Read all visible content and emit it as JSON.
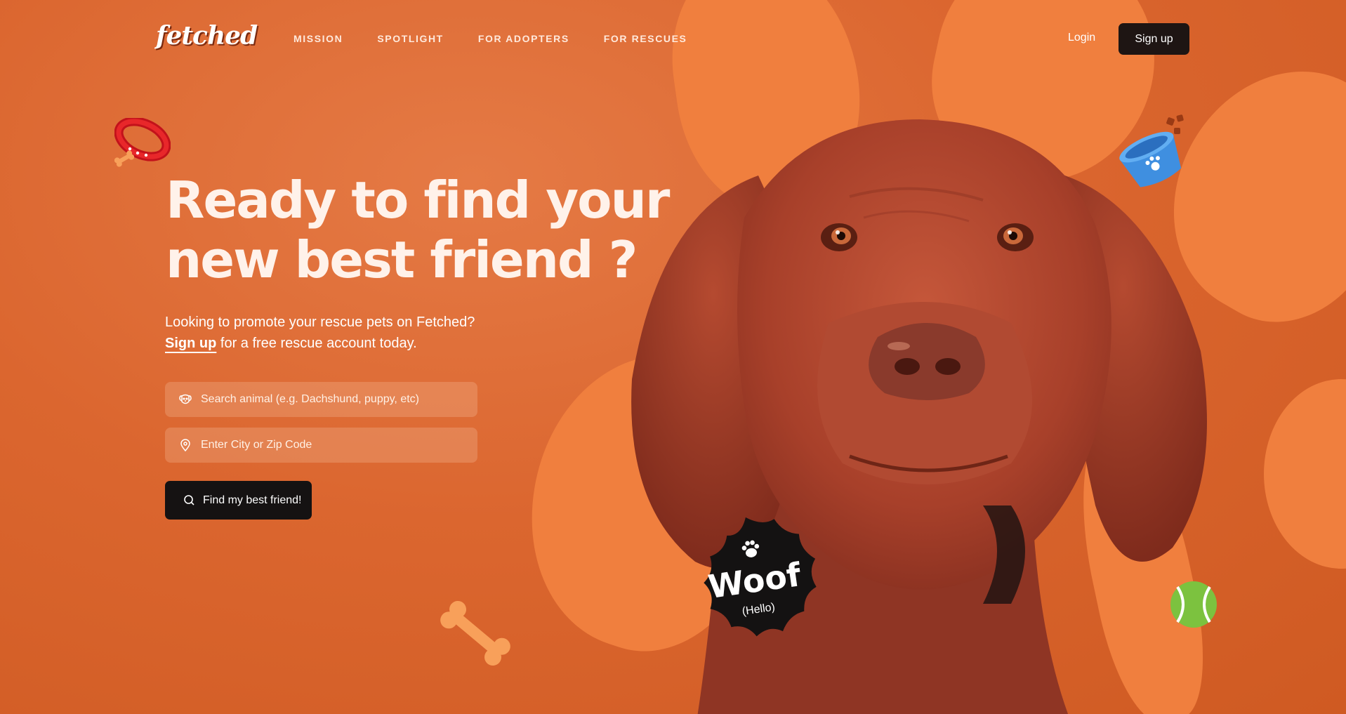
{
  "brand": {
    "logo_text": "fetched"
  },
  "nav": {
    "links": [
      {
        "label": "MISSION"
      },
      {
        "label": "SPOTLIGHT"
      },
      {
        "label": "FOR ADOPTERS"
      },
      {
        "label": "FOR RESCUES"
      }
    ],
    "login_label": "Login",
    "signup_label": "Sign up"
  },
  "hero": {
    "headline_line1": "Ready to find your",
    "headline_line2": "new best friend ?",
    "subtitle_line1": "Looking to promote your rescue pets on Fetched?",
    "subtitle_link": "Sign up",
    "subtitle_line2_rest": " for a free rescue account today.",
    "search_animal_placeholder": "Search animal (e.g. Dachshund, puppy, etc)",
    "location_placeholder": "Enter City or Zip Code",
    "cta_label": "Find my best friend!"
  },
  "badge": {
    "main": "Woof",
    "sub": "(Hello)"
  },
  "colors": {
    "background": "#d9622a",
    "blob": "#f07f3e",
    "button_dark": "#151212",
    "dog": "#b84a2c"
  },
  "icons": [
    "dog-face-icon",
    "location-pin-icon",
    "search-icon",
    "paw-icon",
    "collar-sticker",
    "pet-bowl-sticker",
    "bone-sticker",
    "tennis-ball-sticker"
  ]
}
